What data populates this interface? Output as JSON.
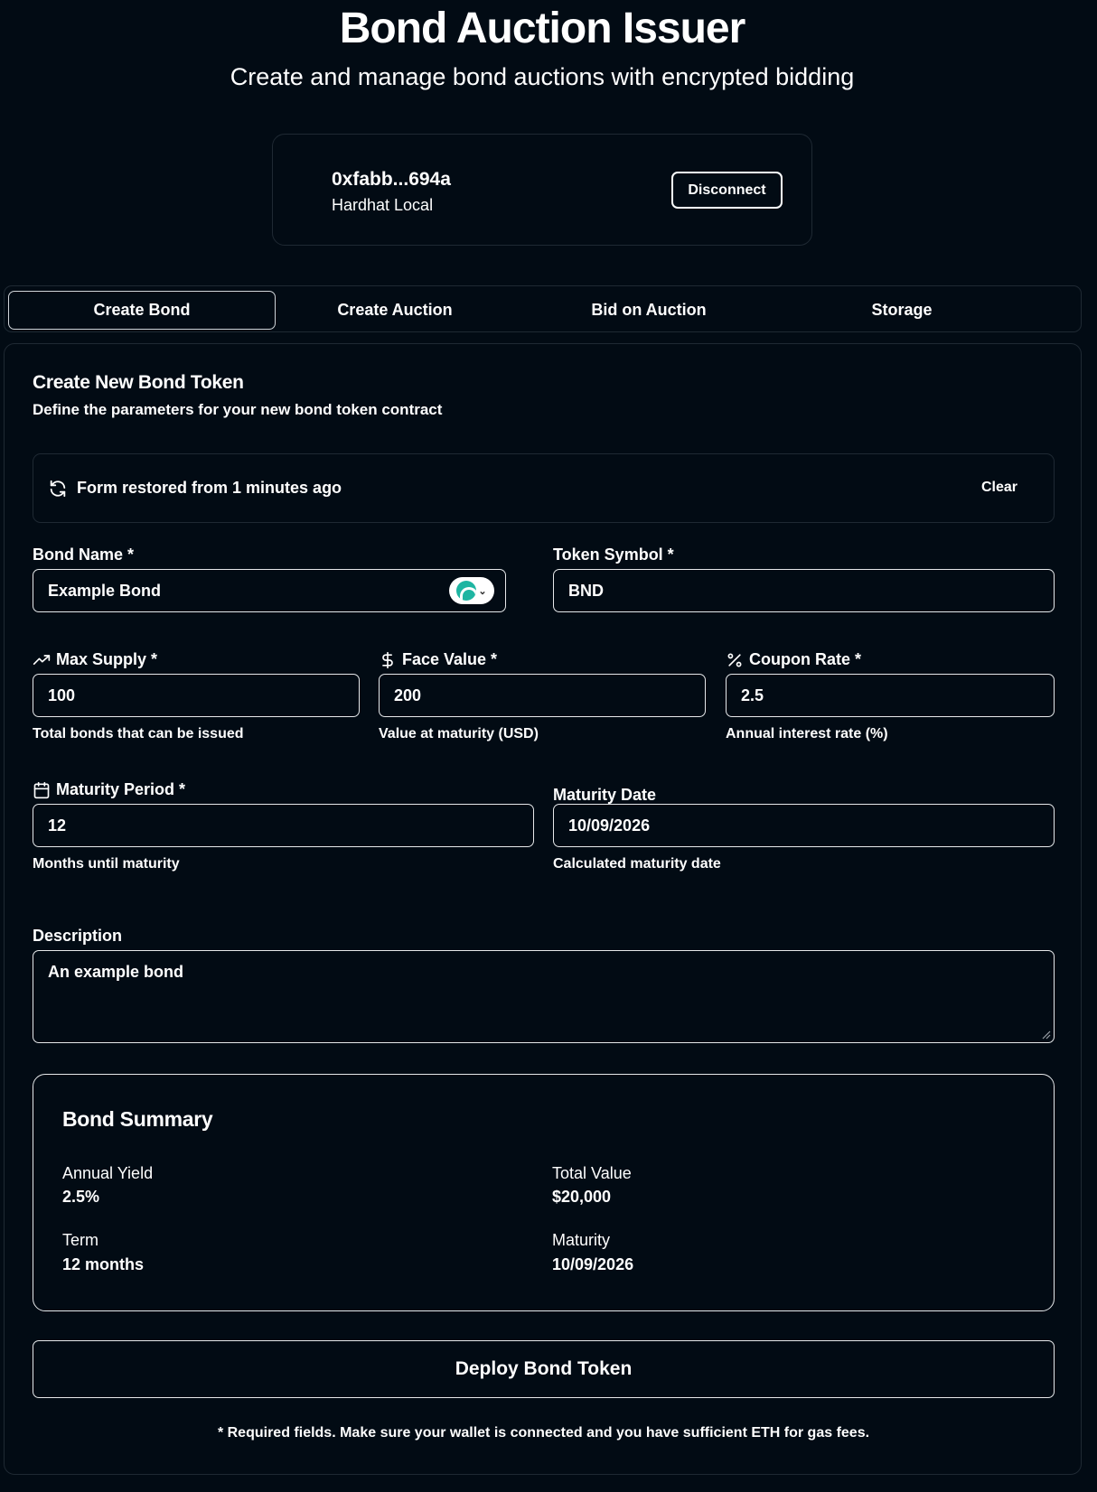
{
  "header": {
    "title": "Bond Auction Issuer",
    "subtitle": "Create and manage bond auctions with encrypted bidding"
  },
  "wallet": {
    "address": "0xfabb...694a",
    "network": "Hardhat Local",
    "disconnect_label": "Disconnect"
  },
  "tabs": [
    {
      "label": "Create Bond",
      "active": true
    },
    {
      "label": "Create Auction",
      "active": false
    },
    {
      "label": "Bid on Auction",
      "active": false
    },
    {
      "label": "Storage",
      "active": false
    }
  ],
  "form": {
    "title": "Create New Bond Token",
    "description": "Define the parameters for your new bond token contract",
    "restore_banner": {
      "text": "Form restored from 1 minutes ago",
      "clear_label": "Clear",
      "icon": "refresh-icon"
    },
    "bond_name": {
      "label": "Bond Name *",
      "value": "Example Bond"
    },
    "token_symbol": {
      "label": "Token Symbol *",
      "value": "BND"
    },
    "max_supply": {
      "label": "Max Supply *",
      "value": "100",
      "hint": "Total bonds that can be issued",
      "icon": "trending-up-icon"
    },
    "face_value": {
      "label": "Face Value *",
      "value": "200",
      "hint": "Value at maturity (USD)",
      "icon": "dollar-icon"
    },
    "coupon_rate": {
      "label": "Coupon Rate *",
      "value": "2.5",
      "hint": "Annual interest rate (%)",
      "icon": "percent-icon"
    },
    "maturity_period": {
      "label": "Maturity Period *",
      "value": "12",
      "hint": "Months until maturity",
      "icon": "calendar-icon"
    },
    "maturity_date": {
      "label": "Maturity Date",
      "value": "10/09/2026",
      "hint": "Calculated maturity date"
    },
    "description_field": {
      "label": "Description",
      "value": "An example bond"
    }
  },
  "summary": {
    "title": "Bond Summary",
    "annual_yield": {
      "label": "Annual Yield",
      "value": "2.5%"
    },
    "total_value": {
      "label": "Total Value",
      "value": "$20,000"
    },
    "term": {
      "label": "Term",
      "value": "12 months"
    },
    "maturity": {
      "label": "Maturity",
      "value": "10/09/2026"
    }
  },
  "deploy_label": "Deploy Bond Token",
  "footnote": "* Required fields. Make sure your wallet is connected and you have sufficient ETH for gas fees.",
  "colors": {
    "background": "#020b14",
    "border_dim": "#1f2933",
    "border_bright": "#e6e8ea",
    "extension_accent": "#1fb5a2"
  }
}
